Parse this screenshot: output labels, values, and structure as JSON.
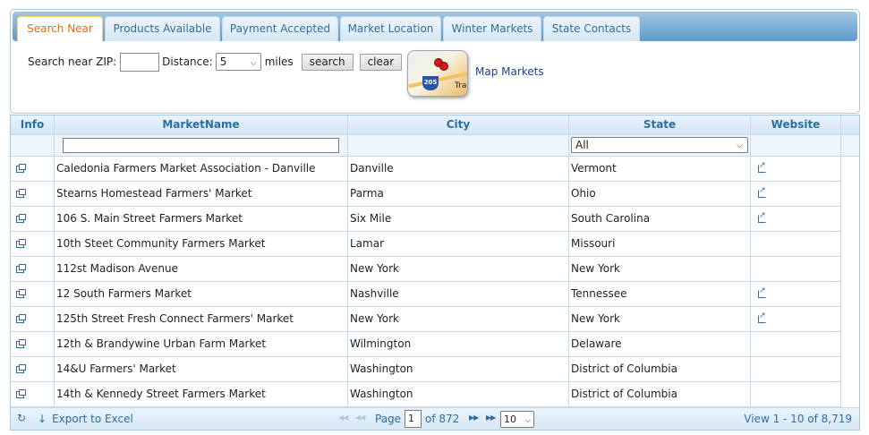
{
  "tabs": [
    {
      "label": "Search Near",
      "active": true
    },
    {
      "label": "Products Available",
      "active": false
    },
    {
      "label": "Payment Accepted",
      "active": false
    },
    {
      "label": "Market Location",
      "active": false
    },
    {
      "label": "Winter Markets",
      "active": false
    },
    {
      "label": "State Contacts",
      "active": false
    }
  ],
  "search": {
    "zip_label": "Search near ZIP:",
    "zip_value": "",
    "distance_label": "Distance:",
    "distance_value": "5",
    "miles_label": "miles",
    "search_button": "search",
    "clear_button": "clear",
    "map_label": "Map Markets",
    "map_thumb_badge": "205",
    "map_thumb_text": "Tra"
  },
  "grid": {
    "columns": [
      "Info",
      "MarketName",
      "City",
      "State",
      "Website"
    ],
    "state_filter_value": "All",
    "rows": [
      {
        "name": "Caledonia Farmers Market Association - Danville",
        "city": "Danville",
        "state": "Vermont",
        "website": true
      },
      {
        "name": "Stearns Homestead Farmers' Market",
        "city": "Parma",
        "state": "Ohio",
        "website": true
      },
      {
        "name": "106 S. Main Street Farmers Market",
        "city": "Six Mile",
        "state": "South Carolina",
        "website": true
      },
      {
        "name": "10th Steet Community Farmers Market",
        "city": "Lamar",
        "state": "Missouri",
        "website": false
      },
      {
        "name": "112st Madison Avenue",
        "city": "New York",
        "state": "New York",
        "website": false
      },
      {
        "name": "12 South Farmers Market",
        "city": "Nashville",
        "state": "Tennessee",
        "website": true
      },
      {
        "name": "125th Street Fresh Connect Farmers' Market",
        "city": "New York",
        "state": "New York",
        "website": true
      },
      {
        "name": "12th & Brandywine Urban Farm Market",
        "city": "Wilmington",
        "state": "Delaware",
        "website": false
      },
      {
        "name": "14&U Farmers' Market",
        "city": "Washington",
        "state": "District of Columbia",
        "website": false
      },
      {
        "name": "14th & Kennedy Street Farmers Market",
        "city": "Washington",
        "state": "District of Columbia",
        "website": false
      }
    ]
  },
  "pager": {
    "export_label": "Export to Excel",
    "page_label": "Page",
    "page_value": "1",
    "of_label": "of 872",
    "rows_per_page": "10",
    "view_label": "View 1 - 10 of 8,719"
  },
  "colors": {
    "accent": "#2e6e9e",
    "active_tab_text": "#e17009",
    "border": "#a6c9e2",
    "link": "#1d3f94"
  }
}
